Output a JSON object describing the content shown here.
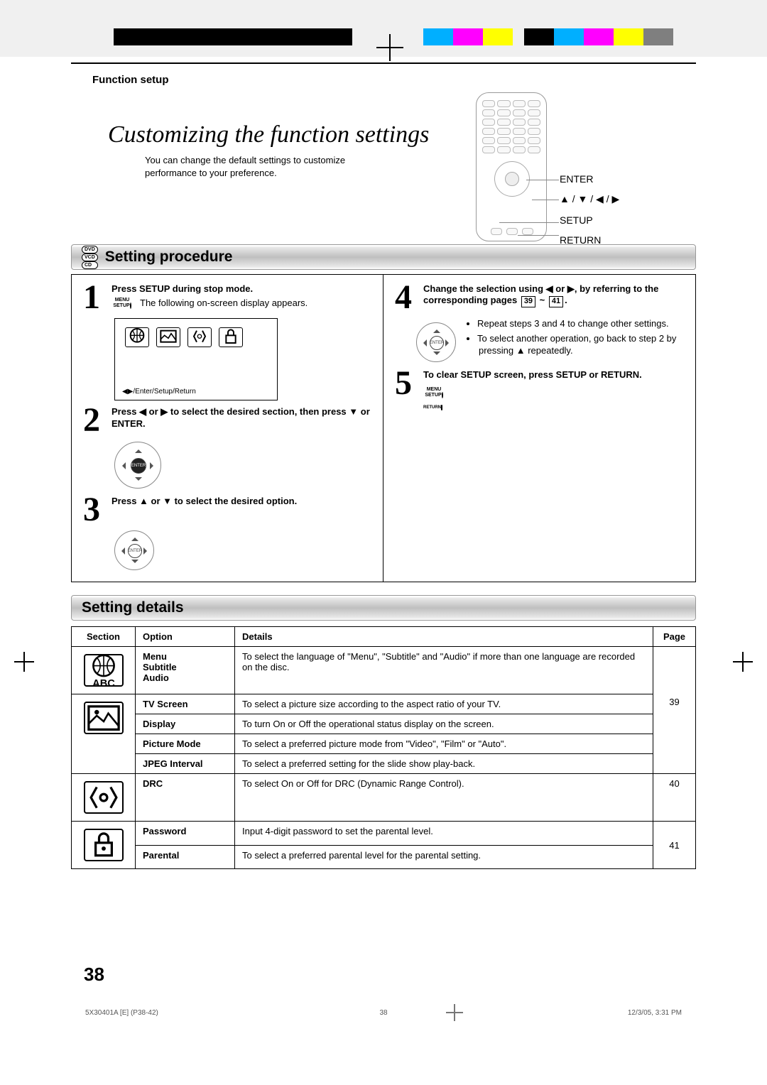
{
  "header": {
    "section_label": "Function setup"
  },
  "title": "Customizing the function settings",
  "description": "You can change the default settings to customize performance to your preference.",
  "remote_labels": {
    "enter": "ENTER",
    "arrows": "▲ / ▼ / ◀ / ▶",
    "setup": "SETUP",
    "return": "RETURN"
  },
  "disc_types": [
    "DVD",
    "VCD",
    "CD"
  ],
  "procedure": {
    "heading": "Setting procedure",
    "steps": [
      {
        "n": "1",
        "title": "Press SETUP during stop mode.",
        "text": "The following on-screen display appears.",
        "osd_footer": "◀▶/Enter/Setup/Return",
        "menu_btn": "MENU\nSETUP"
      },
      {
        "n": "2",
        "title": "Press ◀ or ▶ to select the desired section, then press ▼ or ENTER."
      },
      {
        "n": "3",
        "title": "Press ▲ or ▼ to select the desired option."
      },
      {
        "n": "4",
        "title_pre": "Change the selection using ◀ or ▶, by referring to the corresponding pages ",
        "page_from": "39",
        "page_to": "41",
        "bullets": [
          "Repeat steps 3 and 4 to change other settings.",
          "To select another operation, go back to step 2 by pressing ▲ repeatedly."
        ]
      },
      {
        "n": "5",
        "title": "To clear SETUP screen, press SETUP or RETURN.",
        "menu_btn": "MENU\nSETUP",
        "return_btn": "RETURN"
      }
    ]
  },
  "details": {
    "heading": "Setting details",
    "columns": {
      "section": "Section",
      "option": "Option",
      "details": "Details",
      "page": "Page"
    },
    "groups": [
      {
        "icon": "globe-abc",
        "page": "",
        "rows": [
          {
            "option": "Menu\nSubtitle\nAudio",
            "details": "To select the language of \"Menu\", \"Subtitle\" and \"Audio\" if more than one language are recorded on the disc.",
            "page": ""
          }
        ]
      },
      {
        "icon": "picture",
        "page": "",
        "rows": [
          {
            "option": "TV Screen",
            "details": "To select a picture size according to the aspect ratio of your TV.",
            "page": "39"
          },
          {
            "option": "Display",
            "details": "To turn On or Off the operational status display on the screen.",
            "page": ""
          },
          {
            "option": "Picture Mode",
            "details": "To select a preferred picture mode from \"Video\", \"Film\" or \"Auto\".",
            "page": ""
          },
          {
            "option": "JPEG Interval",
            "details": "To select a preferred setting for the slide show play-back.",
            "page": ""
          }
        ]
      },
      {
        "icon": "audio",
        "page": "40",
        "rows": [
          {
            "option": "DRC",
            "details": "To select On or Off for DRC (Dynamic Range Control).",
            "page": "40"
          }
        ]
      },
      {
        "icon": "lock",
        "page": "41",
        "rows": [
          {
            "option": "Password",
            "details": "Input 4-digit password to set the parental level.",
            "page": ""
          },
          {
            "option": "Parental",
            "details": "To select a preferred parental level for the parental setting.",
            "page": "41"
          }
        ]
      }
    ]
  },
  "page_number": "38",
  "folio": {
    "left": "5X30401A [E] (P38-42)",
    "center": "38",
    "right": "12/3/05, 3:31 PM"
  }
}
